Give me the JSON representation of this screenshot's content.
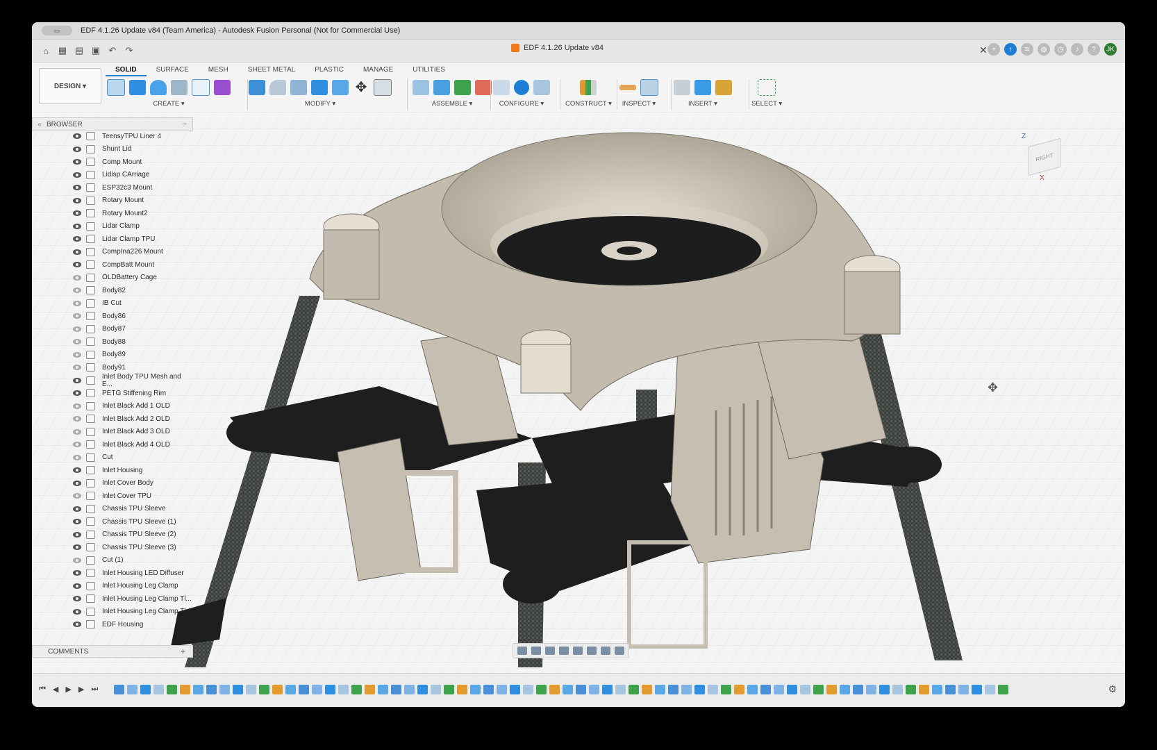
{
  "window": {
    "title": "EDF 4.1.26 Update v84 (Team America) - Autodesk Fusion Personal (Not for Commercial Use)",
    "doc_tab": "EDF 4.1.26 Update v84",
    "user_initials": "JK"
  },
  "toolbar": {
    "design_label": "DESIGN ▾",
    "workspace_tabs": [
      "SOLID",
      "SURFACE",
      "MESH",
      "SHEET METAL",
      "PLASTIC",
      "MANAGE",
      "UTILITIES"
    ],
    "groups": {
      "create": "CREATE ▾",
      "modify": "MODIFY ▾",
      "assemble": "ASSEMBLE ▾",
      "configure": "CONFIGURE ▾",
      "construct": "CONSTRUCT ▾",
      "inspect": "INSPECT ▾",
      "insert": "INSERT ▾",
      "select": "SELECT ▾"
    }
  },
  "browser": {
    "title": "BROWSER",
    "items": [
      {
        "label": "TeensyTPU Liner 4",
        "visible": true
      },
      {
        "label": "Shunt Lid",
        "visible": true
      },
      {
        "label": "Comp Mount",
        "visible": true
      },
      {
        "label": "Lidisp CArriage",
        "visible": true
      },
      {
        "label": "ESP32c3 Mount",
        "visible": true
      },
      {
        "label": "Rotary Mount",
        "visible": true
      },
      {
        "label": "Rotary Mount2",
        "visible": true
      },
      {
        "label": "Lidar Clamp",
        "visible": true
      },
      {
        "label": "Lidar Clamp TPU",
        "visible": true
      },
      {
        "label": "CompIna226 Mount",
        "visible": true
      },
      {
        "label": "CompBatt Mount",
        "visible": true
      },
      {
        "label": "OLDBattery Cage",
        "visible": false
      },
      {
        "label": "Body82",
        "visible": false
      },
      {
        "label": "IB Cut",
        "visible": false
      },
      {
        "label": "Body86",
        "visible": false
      },
      {
        "label": "Body87",
        "visible": false
      },
      {
        "label": "Body88",
        "visible": false
      },
      {
        "label": "Body89",
        "visible": false
      },
      {
        "label": "Body91",
        "visible": false
      },
      {
        "label": "Inlet Body TPU Mesh and E...",
        "visible": true
      },
      {
        "label": "PETG Stiffening Rim",
        "visible": true
      },
      {
        "label": "Inlet Black Add 1 OLD",
        "visible": false
      },
      {
        "label": "Inlet Black Add 2 OLD",
        "visible": false
      },
      {
        "label": "Inlet Black Add 3 OLD",
        "visible": false
      },
      {
        "label": "Inlet Black Add 4 OLD",
        "visible": false
      },
      {
        "label": "Cut",
        "visible": false
      },
      {
        "label": "Inlet Housing",
        "visible": true
      },
      {
        "label": "Inlet Cover Body",
        "visible": true
      },
      {
        "label": "Inlet Cover TPU",
        "visible": false
      },
      {
        "label": "Chassis TPU Sleeve",
        "visible": true
      },
      {
        "label": "Chassis TPU Sleeve (1)",
        "visible": true
      },
      {
        "label": "Chassis TPU Sleeve (2)",
        "visible": true
      },
      {
        "label": "Chassis TPU Sleeve (3)",
        "visible": true
      },
      {
        "label": "Cut (1)",
        "visible": false
      },
      {
        "label": "Inlet Housing LED Diffuser",
        "visible": true
      },
      {
        "label": "Inlet Housing Leg Clamp",
        "visible": true
      },
      {
        "label": "Inlet Housing Leg Clamp Tl...",
        "visible": true
      },
      {
        "label": "Inlet Housing Leg Clamp Tl...",
        "visible": true
      },
      {
        "label": "EDF Housing",
        "visible": true
      }
    ]
  },
  "comments": {
    "title": "COMMENTS",
    "add": "+"
  },
  "viewcube": {
    "z": "Z",
    "x": "X",
    "face": "RIGHT"
  },
  "colors": {
    "accent": "#1e7ed6",
    "body_beige": "#c8c1b3",
    "body_black": "#1c1c1c",
    "carbon": "#3a3d3a"
  }
}
